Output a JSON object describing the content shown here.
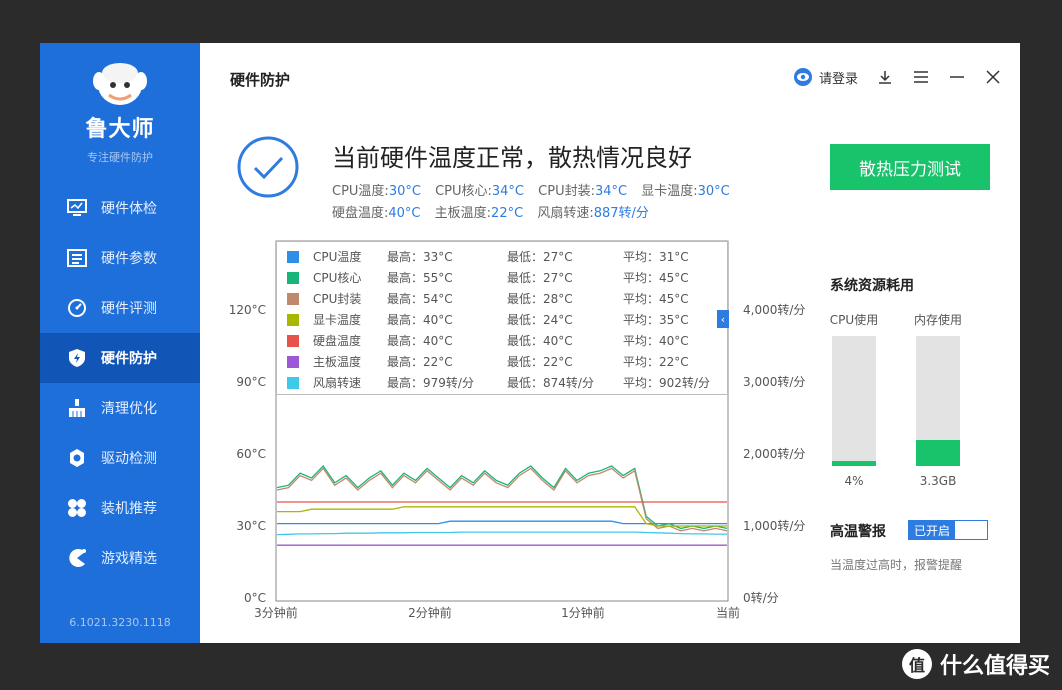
{
  "sidebar": {
    "brand": "鲁大师",
    "tagline": "专注硬件防护",
    "items": [
      {
        "label": "硬件体检",
        "icon": "monitor-icon"
      },
      {
        "label": "硬件参数",
        "icon": "list-icon"
      },
      {
        "label": "硬件评测",
        "icon": "gauge-icon"
      },
      {
        "label": "硬件防护",
        "icon": "shield-icon",
        "active": true
      },
      {
        "label": "清理优化",
        "icon": "broom-icon"
      },
      {
        "label": "驱动检测",
        "icon": "gear-icon"
      },
      {
        "label": "装机推荐",
        "icon": "grid-icon"
      },
      {
        "label": "游戏精选",
        "icon": "gamepad-icon"
      }
    ],
    "version": "6.1021.3230.1118"
  },
  "header": {
    "title": "硬件防护",
    "login": "请登录"
  },
  "status": {
    "headline": "当前硬件温度正常，散热情况良好",
    "readings": [
      {
        "label": "CPU温度:",
        "value": "30°C"
      },
      {
        "label": "CPU核心:",
        "value": "34°C"
      },
      {
        "label": "CPU封装:",
        "value": "34°C"
      },
      {
        "label": "显卡温度:",
        "value": "30°C"
      },
      {
        "label": "硬盘温度:",
        "value": "40°C"
      },
      {
        "label": "主板温度:",
        "value": "22°C"
      },
      {
        "label": "风扇转速:",
        "value": "887转/分"
      }
    ],
    "stress_button": "散热压力测试"
  },
  "chart_data": {
    "type": "line",
    "y_left_ticks": [
      "120°C",
      "90°C",
      "60°C",
      "30°C",
      "0°C"
    ],
    "y_right_ticks": [
      "4,000转/分",
      "3,000转/分",
      "2,000转/分",
      "1,000转/分",
      "0转/分"
    ],
    "x_ticks": [
      "3分钟前",
      "2分钟前",
      "1分钟前",
      "当前"
    ],
    "ylim_left": [
      0,
      120
    ],
    "ylim_right": [
      0,
      4000
    ],
    "series": [
      {
        "name": "CPU温度",
        "color": "#2e8fe6",
        "max": "最高：33°C",
        "min": "最低：27°C",
        "avg": "平均：31°C",
        "axis": "left",
        "values": [
          31,
          31,
          31,
          31,
          31,
          31,
          31,
          31,
          31,
          31,
          31,
          31,
          31,
          31,
          31,
          32,
          32,
          32,
          32,
          32,
          32,
          32,
          32,
          32,
          32,
          32,
          32,
          32,
          32,
          32,
          31,
          31,
          31,
          31,
          31,
          31,
          31,
          31,
          31,
          31
        ]
      },
      {
        "name": "CPU核心",
        "color": "#19b47a",
        "max": "最高：55°C",
        "min": "最低：27°C",
        "avg": "平均：45°C",
        "axis": "left",
        "values": [
          46,
          47,
          52,
          50,
          55,
          48,
          51,
          46,
          50,
          53,
          47,
          52,
          49,
          54,
          50,
          46,
          51,
          48,
          53,
          49,
          47,
          52,
          55,
          50,
          46,
          54,
          49,
          52,
          53,
          55,
          51,
          54,
          34,
          30,
          31,
          29,
          30,
          29,
          30,
          29
        ]
      },
      {
        "name": "CPU封装",
        "color": "#c08a6a",
        "max": "最高：54°C",
        "min": "最低：28°C",
        "avg": "平均：45°C",
        "axis": "left",
        "values": [
          45,
          46,
          51,
          49,
          54,
          47,
          50,
          45,
          49,
          52,
          46,
          51,
          48,
          53,
          49,
          45,
          50,
          47,
          52,
          48,
          46,
          51,
          54,
          49,
          45,
          53,
          48,
          51,
          52,
          54,
          50,
          53,
          33,
          29,
          30,
          28,
          29,
          28,
          29,
          28
        ]
      },
      {
        "name": "显卡温度",
        "color": "#a8b800",
        "max": "最高：40°C",
        "min": "最低：24°C",
        "avg": "平均：35°C",
        "axis": "left",
        "values": [
          36,
          36,
          36,
          37,
          37,
          37,
          37,
          37,
          37,
          37,
          37,
          38,
          38,
          38,
          38,
          38,
          38,
          38,
          38,
          38,
          38,
          38,
          38,
          38,
          38,
          38,
          38,
          38,
          38,
          38,
          38,
          38,
          31,
          30,
          30,
          30,
          30,
          30,
          30,
          30
        ]
      },
      {
        "name": "硬盘温度",
        "color": "#e6534a",
        "max": "最高：40°C",
        "min": "最低：40°C",
        "avg": "平均：40°C",
        "axis": "left",
        "values": [
          40,
          40,
          40,
          40,
          40,
          40,
          40,
          40,
          40,
          40,
          40,
          40,
          40,
          40,
          40,
          40,
          40,
          40,
          40,
          40,
          40,
          40,
          40,
          40,
          40,
          40,
          40,
          40,
          40,
          40,
          40,
          40,
          40,
          40,
          40,
          40,
          40,
          40,
          40,
          40
        ]
      },
      {
        "name": "主板温度",
        "color": "#9b59d6",
        "max": "最高：22°C",
        "min": "最低：22°C",
        "avg": "平均：22°C",
        "axis": "left",
        "values": [
          22,
          22,
          22,
          22,
          22,
          22,
          22,
          22,
          22,
          22,
          22,
          22,
          22,
          22,
          22,
          22,
          22,
          22,
          22,
          22,
          22,
          22,
          22,
          22,
          22,
          22,
          22,
          22,
          22,
          22,
          22,
          22,
          22,
          22,
          22,
          22,
          22,
          22,
          22,
          22
        ]
      },
      {
        "name": "风扇转速",
        "color": "#40c8e8",
        "max": "最高：979转/分",
        "min": "最低：874转/分",
        "avg": "平均：902转/分",
        "axis": "right",
        "values": [
          880,
          885,
          890,
          890,
          895,
          895,
          900,
          900,
          900,
          905,
          905,
          905,
          910,
          910,
          910,
          910,
          915,
          915,
          915,
          915,
          915,
          915,
          915,
          915,
          915,
          915,
          915,
          915,
          915,
          915,
          915,
          915,
          910,
          905,
          900,
          895,
          890,
          890,
          887,
          887
        ]
      }
    ]
  },
  "resources": {
    "title": "系统资源耗用",
    "cpu_label": "CPU使用",
    "cpu_value": "4%",
    "cpu_fraction": 0.04,
    "mem_label": "内存使用",
    "mem_value": "3.3GB",
    "mem_fraction": 0.2
  },
  "alarm": {
    "label": "高温警报",
    "toggle_text": "已开启",
    "desc": "当温度过高时，报警提醒"
  },
  "watermark": {
    "text": "什么值得买",
    "logo_char": "值"
  }
}
